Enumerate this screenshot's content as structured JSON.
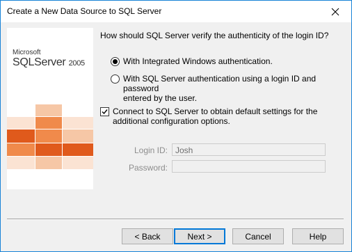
{
  "window": {
    "title": "Create a New Data Source to SQL Server"
  },
  "logo": {
    "brand": "Microsoft",
    "product": "SQLServer",
    "version": "2005"
  },
  "question": "How should SQL Server verify the authenticity of the login ID?",
  "options": [
    {
      "label": "With Integrated Windows authentication.",
      "selected": true
    },
    {
      "label_line1": "With SQL Server authentication using a login ID and password",
      "label_line2": "entered by the user.",
      "selected": false
    }
  ],
  "connect": {
    "label_line1": "Connect to SQL Server to obtain default settings for the",
    "label_line2": "additional configuration options.",
    "checked": true
  },
  "fields": {
    "login_label": "Login ID:",
    "login_value": "Josh",
    "password_label": "Password:",
    "password_value": ""
  },
  "buttons": {
    "back": "< Back",
    "next": "Next >",
    "cancel": "Cancel",
    "help": "Help"
  },
  "colors": {
    "accent": "#0078d7",
    "tile_dark": "#e05a1c",
    "tile_mid": "#f08a4b",
    "tile_light": "#f6c7a6"
  }
}
